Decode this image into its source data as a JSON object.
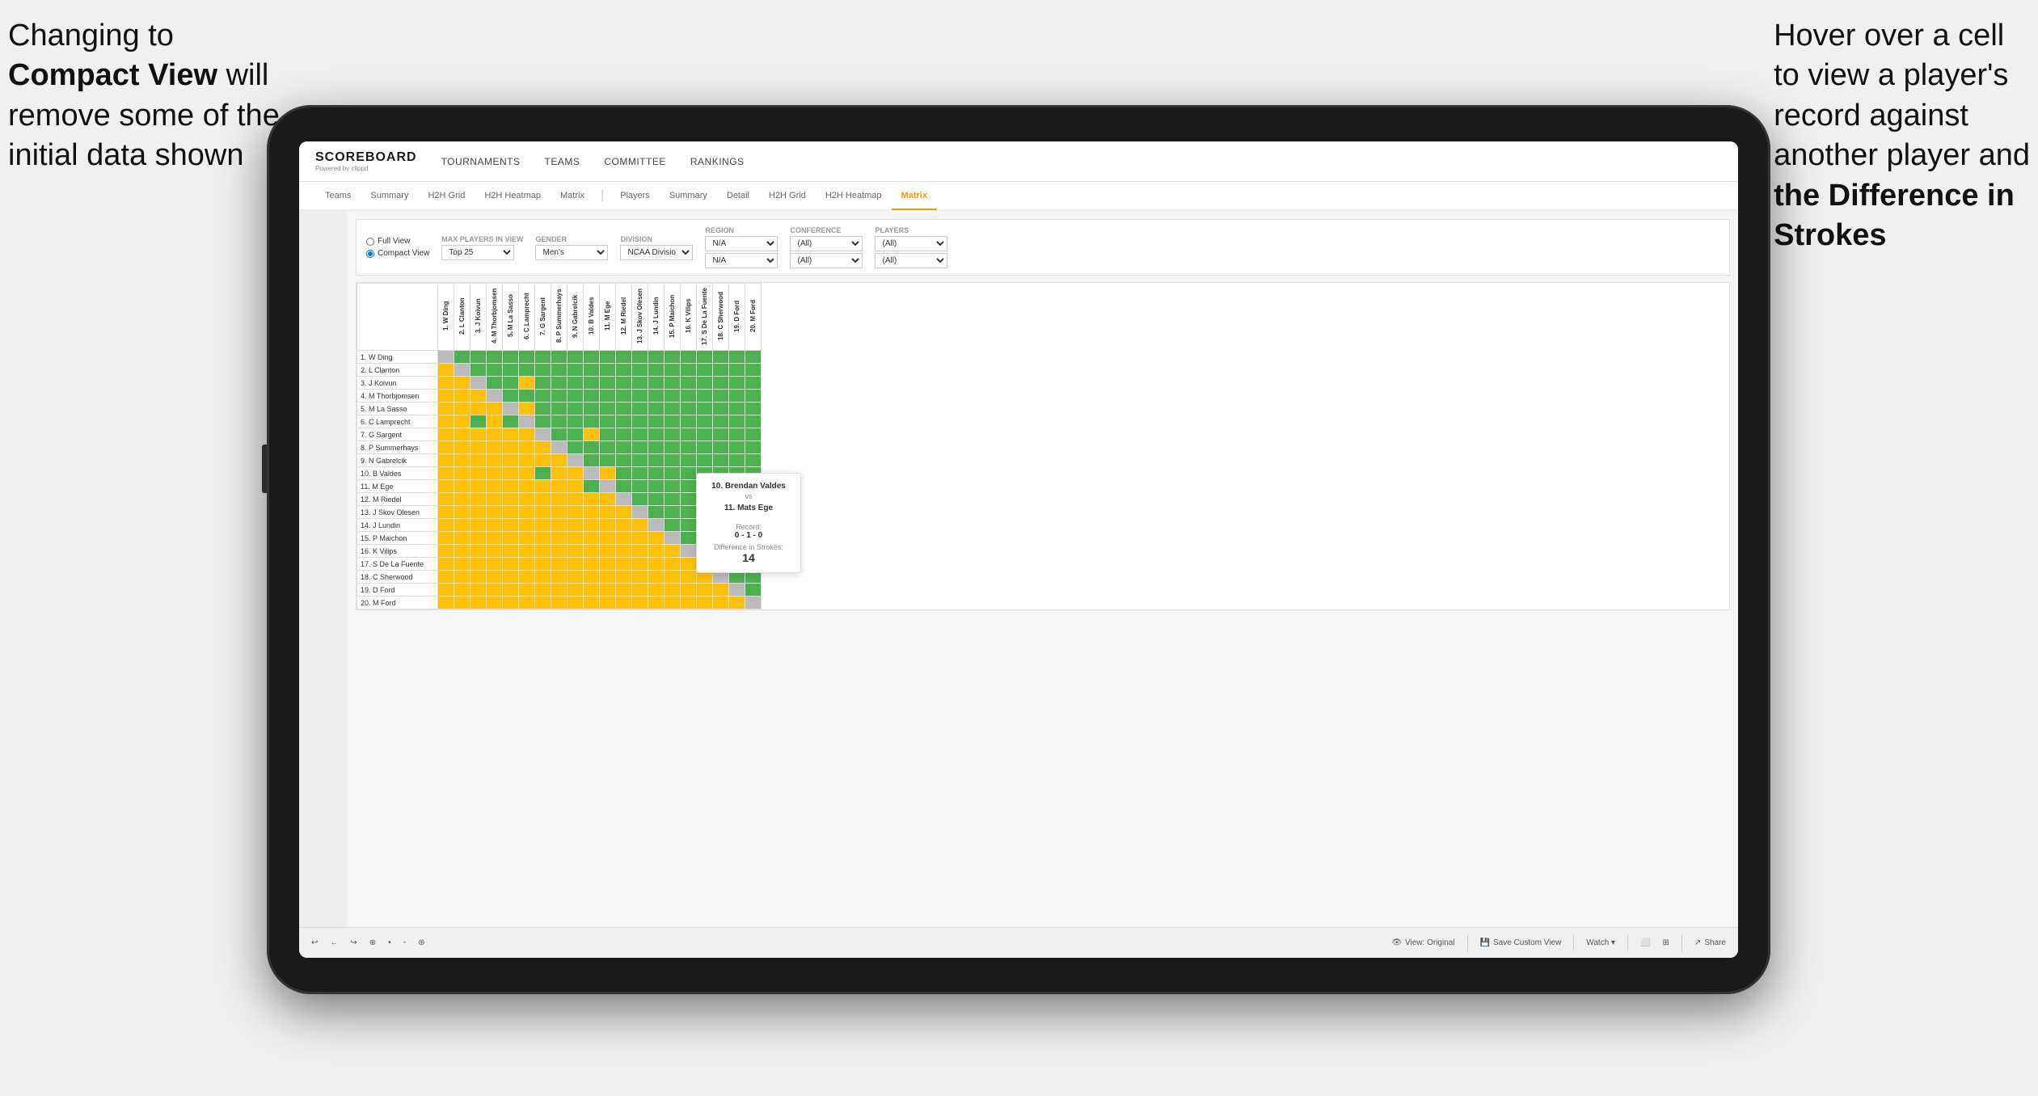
{
  "annotations": {
    "left": {
      "line1": "Changing to",
      "line2bold": "Compact View",
      "line2rest": " will",
      "line3": "remove some of the",
      "line4": "initial data shown"
    },
    "right": {
      "line1": "Hover over a cell",
      "line2": "to view a player's",
      "line3": "record against",
      "line4": "another player and",
      "line5bold": "the Difference in",
      "line6bold": "Strokes"
    }
  },
  "nav": {
    "logo": "SCOREBOARD",
    "logoSub": "Powered by clippd",
    "items": [
      "TOURNAMENTS",
      "TEAMS",
      "COMMITTEE",
      "RANKINGS"
    ]
  },
  "subNav": {
    "group1": [
      "Teams",
      "Summary",
      "H2H Grid",
      "H2H Heatmap",
      "Matrix"
    ],
    "group2": [
      "Players",
      "Summary",
      "Detail",
      "H2H Grid",
      "H2H Heatmap",
      "Matrix"
    ],
    "active": "Matrix"
  },
  "filters": {
    "viewOptions": [
      "Full View",
      "Compact View"
    ],
    "selectedView": "Compact View",
    "maxPlayers": {
      "label": "Max players in view",
      "value": "Top 25"
    },
    "gender": {
      "label": "Gender",
      "value": "Men's"
    },
    "division": {
      "label": "Division",
      "value": "NCAA Division I"
    },
    "region": {
      "label": "Region",
      "values": [
        "N/A",
        "N/A"
      ]
    },
    "conference": {
      "label": "Conference",
      "values": [
        "(All)",
        "(All)"
      ]
    },
    "players": {
      "label": "Players",
      "values": [
        "(All)",
        "(All)"
      ]
    }
  },
  "matrix": {
    "colHeaders": [
      "1. W Ding",
      "2. L Clanton",
      "3. J Koivun",
      "4. M Thorbjomsen",
      "5. M La Sasso",
      "6. C Lamprecht",
      "7. G Sargent",
      "8. P Summerhays",
      "9. N Gabrelcik",
      "10. B Valdes",
      "11. M Ege",
      "12. M Riedel",
      "13. J Skov Olesen",
      "14. J Lundin",
      "15. P Maichon",
      "16. K Vilips",
      "17. S De La Fuente",
      "18. C Sherwood",
      "19. D Ford",
      "20. M Ford"
    ],
    "rows": [
      {
        "label": "1. W Ding",
        "cells": [
          "D",
          "G",
          "G",
          "G",
          "G",
          "G",
          "G",
          "G",
          "G",
          "G",
          "G",
          "G",
          "G",
          "G",
          "G",
          "G",
          "G",
          "G",
          "G",
          "G"
        ]
      },
      {
        "label": "2. L Clanton",
        "cells": [
          "Y",
          "D",
          "G",
          "G",
          "G",
          "G",
          "G",
          "G",
          "G",
          "G",
          "G",
          "G",
          "G",
          "G",
          "G",
          "G",
          "G",
          "G",
          "G",
          "G"
        ]
      },
      {
        "label": "3. J Koivun",
        "cells": [
          "Y",
          "Y",
          "D",
          "G",
          "G",
          "Y",
          "G",
          "G",
          "G",
          "G",
          "G",
          "G",
          "G",
          "G",
          "G",
          "G",
          "G",
          "G",
          "G",
          "G"
        ]
      },
      {
        "label": "4. M Thorbjomsen",
        "cells": [
          "Y",
          "Y",
          "Y",
          "D",
          "G",
          "G",
          "G",
          "G",
          "G",
          "G",
          "G",
          "G",
          "G",
          "G",
          "G",
          "G",
          "G",
          "G",
          "G",
          "G"
        ]
      },
      {
        "label": "5. M La Sasso",
        "cells": [
          "Y",
          "Y",
          "Y",
          "Y",
          "D",
          "Y",
          "G",
          "G",
          "G",
          "G",
          "G",
          "G",
          "G",
          "G",
          "G",
          "G",
          "G",
          "G",
          "G",
          "G"
        ]
      },
      {
        "label": "6. C Lamprecht",
        "cells": [
          "Y",
          "Y",
          "G",
          "Y",
          "G",
          "D",
          "G",
          "G",
          "G",
          "G",
          "G",
          "G",
          "G",
          "G",
          "G",
          "G",
          "G",
          "G",
          "G",
          "G"
        ]
      },
      {
        "label": "7. G Sargent",
        "cells": [
          "Y",
          "Y",
          "Y",
          "Y",
          "Y",
          "Y",
          "D",
          "G",
          "G",
          "Y",
          "G",
          "G",
          "G",
          "G",
          "G",
          "G",
          "G",
          "G",
          "G",
          "G"
        ]
      },
      {
        "label": "8. P Summerhays",
        "cells": [
          "Y",
          "Y",
          "Y",
          "Y",
          "Y",
          "Y",
          "Y",
          "D",
          "G",
          "G",
          "G",
          "G",
          "G",
          "G",
          "G",
          "G",
          "G",
          "G",
          "G",
          "G"
        ]
      },
      {
        "label": "9. N Gabrelcik",
        "cells": [
          "Y",
          "Y",
          "Y",
          "Y",
          "Y",
          "Y",
          "Y",
          "Y",
          "D",
          "G",
          "G",
          "G",
          "G",
          "G",
          "G",
          "G",
          "G",
          "G",
          "G",
          "G"
        ]
      },
      {
        "label": "10. B Valdes",
        "cells": [
          "Y",
          "Y",
          "Y",
          "Y",
          "Y",
          "Y",
          "G",
          "Y",
          "Y",
          "D",
          "Y",
          "G",
          "G",
          "G",
          "G",
          "G",
          "G",
          "G",
          "G",
          "G"
        ]
      },
      {
        "label": "11. M Ege",
        "cells": [
          "Y",
          "Y",
          "Y",
          "Y",
          "Y",
          "Y",
          "Y",
          "Y",
          "Y",
          "G",
          "D",
          "G",
          "G",
          "G",
          "G",
          "G",
          "G",
          "G",
          "G",
          "G"
        ]
      },
      {
        "label": "12. M Riedel",
        "cells": [
          "Y",
          "Y",
          "Y",
          "Y",
          "Y",
          "Y",
          "Y",
          "Y",
          "Y",
          "Y",
          "Y",
          "D",
          "G",
          "G",
          "G",
          "G",
          "G",
          "G",
          "G",
          "G"
        ]
      },
      {
        "label": "13. J Skov Olesen",
        "cells": [
          "Y",
          "Y",
          "Y",
          "Y",
          "Y",
          "Y",
          "Y",
          "Y",
          "Y",
          "Y",
          "Y",
          "Y",
          "D",
          "G",
          "G",
          "G",
          "G",
          "G",
          "G",
          "G"
        ]
      },
      {
        "label": "14. J Lundin",
        "cells": [
          "Y",
          "Y",
          "Y",
          "Y",
          "Y",
          "Y",
          "Y",
          "Y",
          "Y",
          "Y",
          "Y",
          "Y",
          "Y",
          "D",
          "G",
          "G",
          "G",
          "G",
          "G",
          "G"
        ]
      },
      {
        "label": "15. P Maichon",
        "cells": [
          "Y",
          "Y",
          "Y",
          "Y",
          "Y",
          "Y",
          "Y",
          "Y",
          "Y",
          "Y",
          "Y",
          "Y",
          "Y",
          "Y",
          "D",
          "G",
          "G",
          "G",
          "G",
          "G"
        ]
      },
      {
        "label": "16. K Vilips",
        "cells": [
          "Y",
          "Y",
          "Y",
          "Y",
          "Y",
          "Y",
          "Y",
          "Y",
          "Y",
          "Y",
          "Y",
          "Y",
          "Y",
          "Y",
          "Y",
          "D",
          "G",
          "G",
          "G",
          "G"
        ]
      },
      {
        "label": "17. S De La Fuente",
        "cells": [
          "Y",
          "Y",
          "Y",
          "Y",
          "Y",
          "Y",
          "Y",
          "Y",
          "Y",
          "Y",
          "Y",
          "Y",
          "Y",
          "Y",
          "Y",
          "Y",
          "D",
          "G",
          "G",
          "G"
        ]
      },
      {
        "label": "18. C Sherwood",
        "cells": [
          "Y",
          "Y",
          "Y",
          "Y",
          "Y",
          "Y",
          "Y",
          "Y",
          "Y",
          "Y",
          "Y",
          "Y",
          "Y",
          "Y",
          "Y",
          "Y",
          "Y",
          "D",
          "G",
          "G"
        ]
      },
      {
        "label": "19. D Ford",
        "cells": [
          "Y",
          "Y",
          "Y",
          "Y",
          "Y",
          "Y",
          "Y",
          "Y",
          "Y",
          "Y",
          "Y",
          "Y",
          "Y",
          "Y",
          "Y",
          "Y",
          "Y",
          "Y",
          "D",
          "G"
        ]
      },
      {
        "label": "20. M Ford",
        "cells": [
          "Y",
          "Y",
          "Y",
          "Y",
          "Y",
          "Y",
          "Y",
          "Y",
          "Y",
          "Y",
          "Y",
          "Y",
          "Y",
          "Y",
          "Y",
          "Y",
          "Y",
          "Y",
          "Y",
          "D"
        ]
      }
    ]
  },
  "tooltip": {
    "player1": "10. Brendan Valdes",
    "vs": "vs",
    "player2": "11. Mats Ege",
    "recordLabel": "Record:",
    "record": "0 - 1 - 0",
    "diffLabel": "Difference in Strokes:",
    "diff": "14"
  },
  "toolbar": {
    "buttons": [
      "↩",
      "←",
      "↪",
      "⊕",
      "⊙",
      "◎",
      "⊛"
    ],
    "viewOriginal": "View: Original",
    "saveCustomView": "Save Custom View",
    "watch": "Watch ▾",
    "share": "Share"
  }
}
